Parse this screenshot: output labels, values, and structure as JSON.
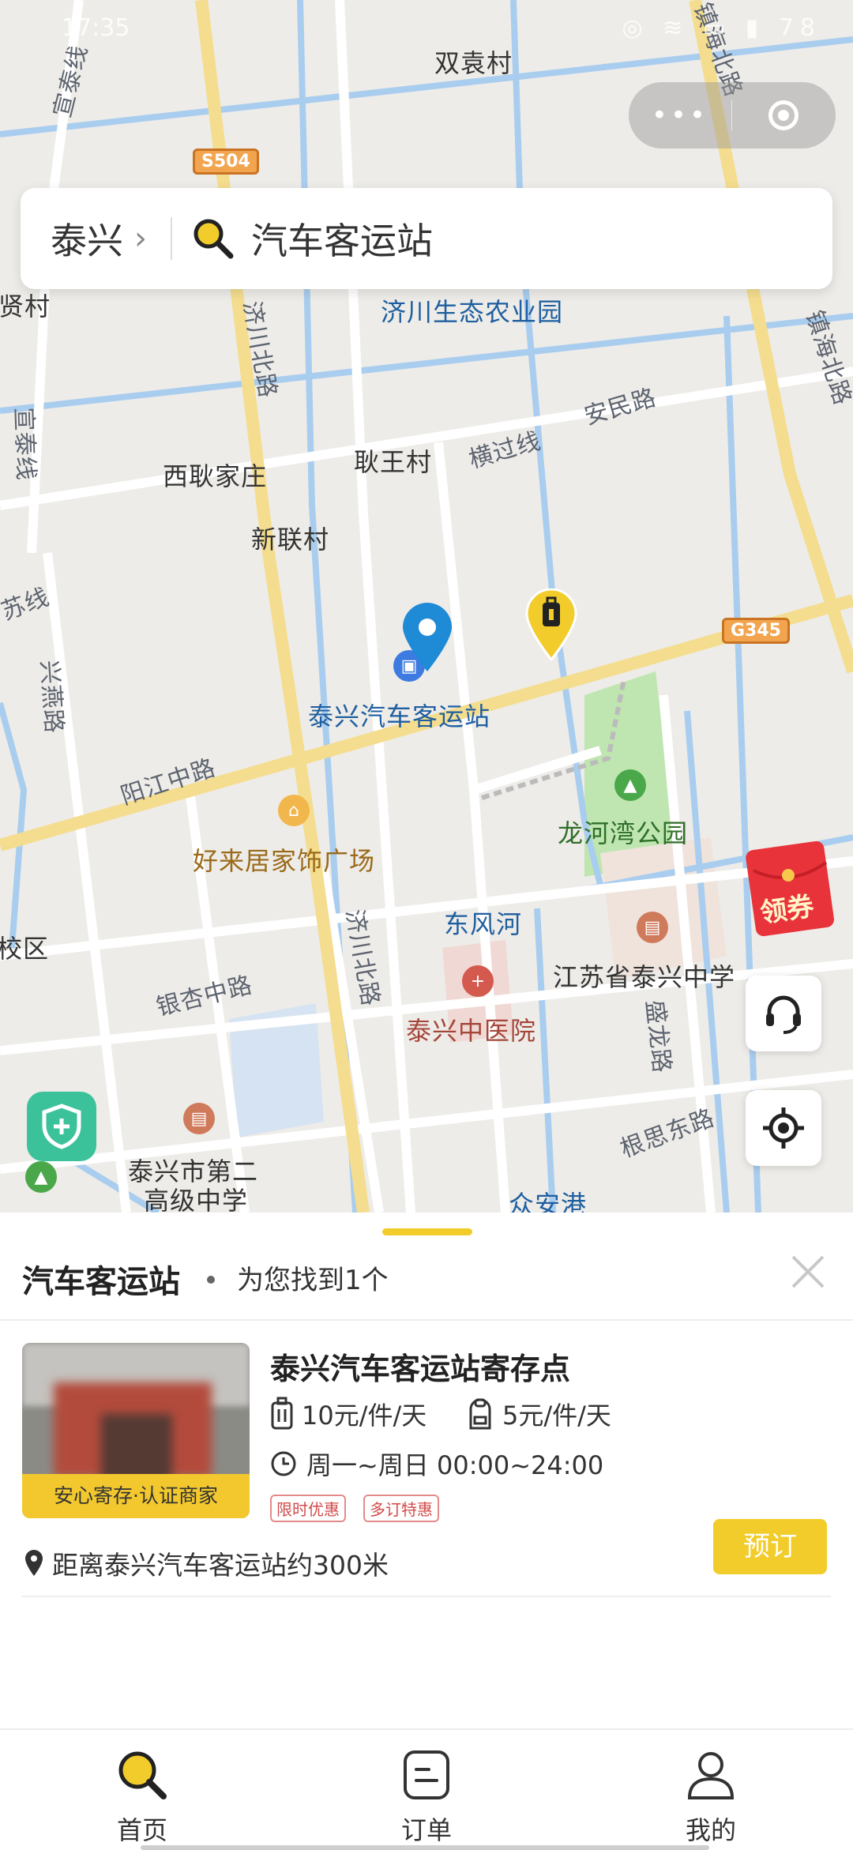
{
  "status_bar": {
    "time": "17:35",
    "battery": "78"
  },
  "search": {
    "city": "泰兴",
    "query": "汽车客运站"
  },
  "map": {
    "labels": {
      "shuangyuan": "双袁村",
      "xianci": "贤村",
      "jichuan_park": "济川生态农业园",
      "xigengjiazhuang": "西耿家庄",
      "gengwang": "耿王村",
      "xinlian": "新联村",
      "station": "泰兴汽车客运站",
      "haolaiju": "好来居家饰广场",
      "longhewan": "龙河湾公园",
      "dongfeng": "东风河",
      "tcm_hospital": "泰兴中医院",
      "taixing_high": "江苏省泰兴中学",
      "second_high_1": "泰兴市第二",
      "second_high_2": "高级中学",
      "zhonganggang": "众安港",
      "jiaoqu": "校区"
    },
    "roads": {
      "yangjiang": "阳江中路",
      "yinxing": "银杏中路",
      "anmin": "安民路",
      "hengguo": "横过线",
      "zhenhai_n": "镇海北路",
      "jichuan_n": "济川北路",
      "jichuan_n2": "济川北路",
      "xingyan": "兴燕路",
      "xuantai": "宣泰线",
      "xuantai2": "宣泰线",
      "su": "苏线",
      "shenglong": "盛龙路",
      "gensi": "根思东路",
      "zhenhai_top": "镇海北路"
    },
    "shields": {
      "s504": "S504",
      "g345": "G345"
    }
  },
  "coupon": {
    "label": "领券"
  },
  "sheet": {
    "title": "汽车客运站",
    "found_text": "为您找到1个",
    "result": {
      "name": "泰兴汽车客运站寄存点",
      "badge": "安心寄存·认证商家",
      "price_luggage": "10元/件/天",
      "price_bag": "5元/件/天",
      "hours": "周一~周日 00:00~24:00",
      "tags": [
        "限时优惠",
        "多订特惠"
      ],
      "distance": "距离泰兴汽车客运站约300米",
      "book_label": "预订"
    }
  },
  "tabbar": {
    "home": "首页",
    "orders": "订单",
    "mine": "我的"
  },
  "colors": {
    "accent": "#f2cc2b",
    "marker_blue": "#1f8ad6",
    "shield_green": "#3cc29b"
  }
}
